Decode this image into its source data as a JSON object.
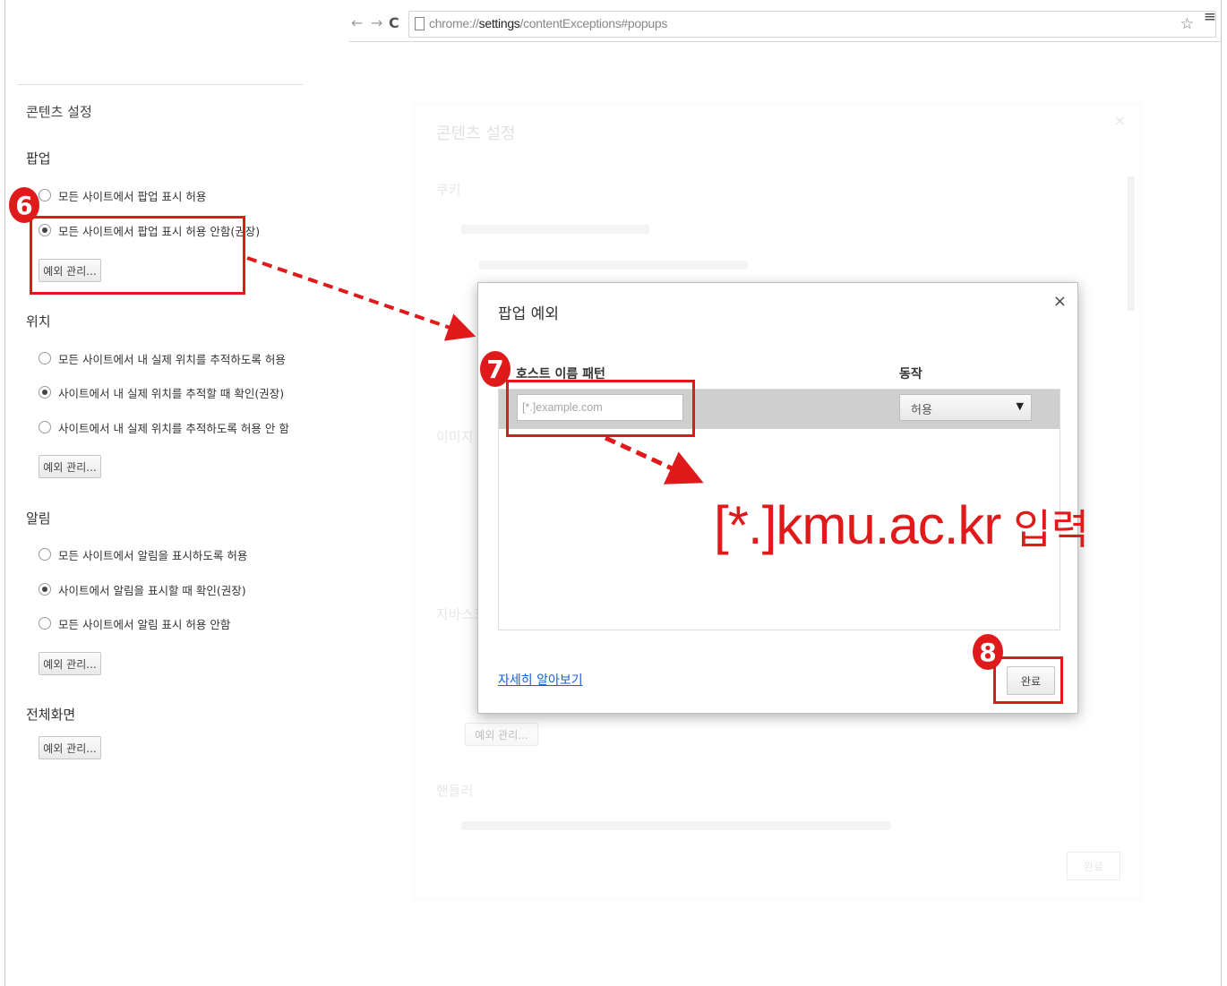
{
  "browser": {
    "url_prefix": "chrome://",
    "url_bold": "settings",
    "url_suffix": "/contentExceptions#popups",
    "back_icon": "←",
    "forward_icon": "→",
    "reload_icon": "C",
    "star_icon": "☆",
    "menu_icon": "≡"
  },
  "left_panel": {
    "title": "콘텐츠 설정",
    "popups": {
      "heading": "팝업",
      "options": [
        "모든 사이트에서 팝업 표시 허용",
        "모든 사이트에서 팝업 표시 허용 안함(권장)"
      ],
      "selected_index": 1,
      "manage_label": "예외 관리..."
    },
    "location": {
      "heading": "위치",
      "options": [
        "모든 사이트에서 내 실제 위치를 추적하도록 허용",
        "사이트에서 내 실제 위치를 추적할 때 확인(권장)",
        "사이트에서 내 실제 위치를 추적하도록 허용 안 함"
      ],
      "selected_index": 1,
      "manage_label": "예외 관리..."
    },
    "notifications": {
      "heading": "알림",
      "options": [
        "모든 사이트에서 알림을 표시하도록 허용",
        "사이트에서 알림을 표시할 때 확인(권장)",
        "모든 사이트에서 알림 표시 허용 안함"
      ],
      "selected_index": 1,
      "manage_label": "예외 관리..."
    },
    "fullscreen": {
      "heading": "전체화면",
      "manage_label": "예외 관리..."
    }
  },
  "background_dialog": {
    "title": "콘텐츠 설정",
    "close": "×",
    "sections": [
      "쿠키",
      "이미지",
      "자바스크립트",
      "핸들러"
    ],
    "manage_label": "예외 관리...",
    "done_label": "완료"
  },
  "popup_dialog": {
    "title": "팝업 예외",
    "close": "×",
    "col_host": "호스트 이름 패턴",
    "col_action": "동작",
    "host_placeholder": "[*.]example.com",
    "action_value": "허용",
    "learn_more": "자세히 알아보기",
    "done_label": "완료"
  },
  "annotations": {
    "badges": [
      "6",
      "7",
      "8"
    ],
    "instruction_text": "[*.]kmu.ac.kr",
    "instruction_suffix": "입력",
    "accent_color": "#e01a1a"
  }
}
